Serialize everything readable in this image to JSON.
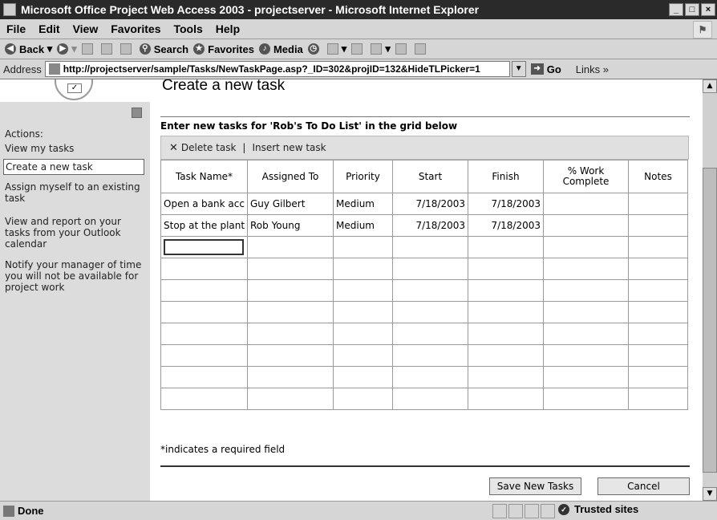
{
  "window": {
    "title": "Microsoft Office Project Web Access 2003 - projectserver - Microsoft Internet Explorer",
    "buttons": [
      "_",
      "□",
      "×"
    ]
  },
  "menubar": {
    "items": [
      "File",
      "Edit",
      "View",
      "Favorites",
      "Tools",
      "Help"
    ]
  },
  "toolbar": {
    "back": "Back",
    "search": "Search",
    "favorites": "Favorites",
    "media": "Media"
  },
  "addressbar": {
    "label": "Address",
    "url": "http://projectserver/sample/Tasks/NewTaskPage.asp?_ID=302&projID=132&HideTLPicker=1",
    "go": "Go",
    "links": "Links"
  },
  "page": {
    "title": "Create a new task"
  },
  "sidebar": {
    "header": "Actions:",
    "items": [
      {
        "label": "View my tasks"
      },
      {
        "label": "Create a new task"
      },
      {
        "label": "Assign myself to an existing task"
      },
      {
        "label": "View and report on your tasks from your Outlook calendar"
      },
      {
        "label": "Notify your manager of time you will not be available for project work"
      }
    ]
  },
  "main": {
    "intro": "Enter new tasks for 'Rob's To Do List' in the grid below",
    "delete_label": "Delete task",
    "insert_label": "Insert new task",
    "separator": "|",
    "columns": [
      "Task Name*",
      "Assigned To",
      "Priority",
      "Start",
      "Finish",
      "% Work Complete",
      "Notes"
    ],
    "rows": [
      [
        "Open a bank acc",
        "Guy Gilbert",
        "Medium",
        "7/18/2003",
        "7/18/2003",
        "",
        ""
      ],
      [
        "Stop at the plant",
        "Rob Young",
        "Medium",
        "7/18/2003",
        "7/18/2003",
        "",
        ""
      ]
    ],
    "required_note": "*indicates a required field",
    "save_label": "Save New Tasks",
    "cancel_label": "Cancel"
  },
  "statusbar": {
    "status": "Done",
    "zone": "Trusted sites"
  }
}
